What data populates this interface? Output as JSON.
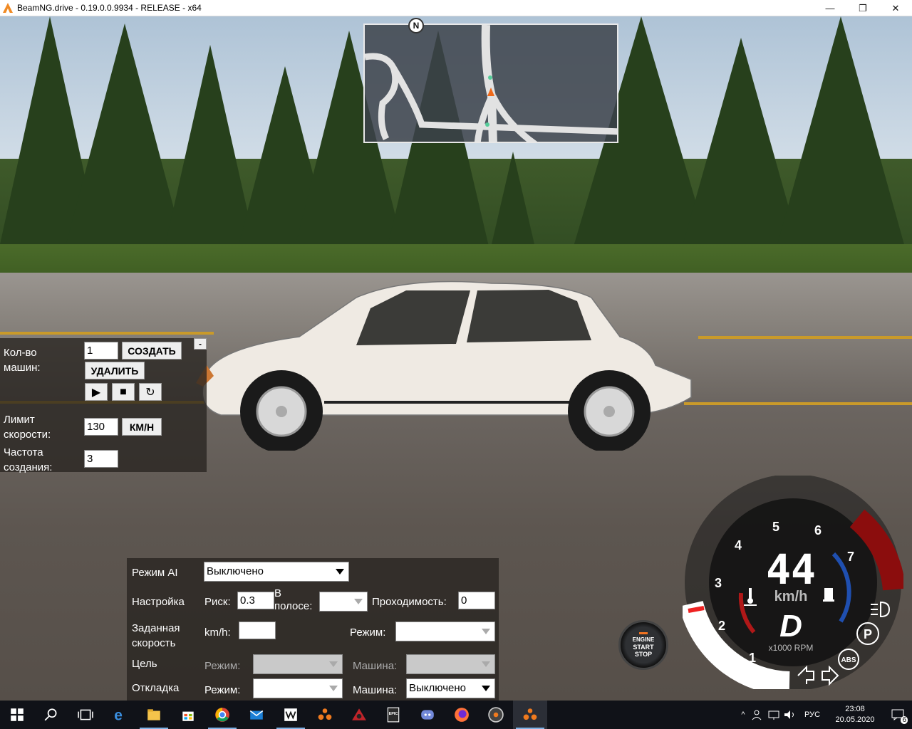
{
  "window": {
    "title": "BeamNG.drive - 0.19.0.0.9934 - RELEASE - x64",
    "minimize_glyph": "—",
    "maximize_glyph": "❐",
    "close_glyph": "✕"
  },
  "minimap": {
    "north_label": "N"
  },
  "spawn_panel": {
    "count_label_1": "Кол-во",
    "count_label_2": "машин:",
    "count_value": "1",
    "create_label": "СОЗДАТЬ",
    "delete_label": "УДАЛИТЬ",
    "collapse_label": "-",
    "play_glyph": "▶",
    "stop_glyph": "■",
    "refresh_glyph": "↻",
    "speed_limit_label_1": "Лимит",
    "speed_limit_label_2": "скорости:",
    "speed_limit_value": "130",
    "speed_unit_label": "КМ/Н",
    "spawn_rate_label_1": "Частота",
    "spawn_rate_label_2": "создания:",
    "spawn_rate_value": "3"
  },
  "ai_panel": {
    "mode_label": "Режим AI",
    "mode_value": "Выключено",
    "tuning_label": "Настройка",
    "risk_label": "Риск:",
    "risk_value": "0.3",
    "lane_label_1": "В",
    "lane_label_2": "полосе:",
    "lane_value": "",
    "offroad_label": "Проходимость:",
    "offroad_value": "0",
    "target_speed_label_1": "Заданная",
    "target_speed_label_2": "скорость",
    "kmh_label": "km/h:",
    "kmh_value": "",
    "speed_mode_label": "Режим:",
    "speed_mode_value": "",
    "target_label": "Цель",
    "target_mode_label": "Режим:",
    "target_mode_value": "",
    "target_vehicle_label": "Машина:",
    "target_vehicle_value": "",
    "debug_label": "Откладка",
    "debug_mode_label": "Режим:",
    "debug_mode_value": "",
    "debug_vehicle_label": "Машина:",
    "debug_vehicle_value": "Выключено"
  },
  "engine_button": {
    "line1": "ENGINE",
    "line2": "START",
    "line3": "STOP"
  },
  "gauge": {
    "speed": "44",
    "unit": "km/h",
    "gear": "D",
    "rpm_label": "x1000 RPM",
    "rpm_ticks": [
      "1",
      "2",
      "3",
      "4",
      "5",
      "6",
      "7"
    ],
    "abs_label": "ABS",
    "parking_label": "P",
    "redline_color": "#8b0d0d",
    "rpm_fill_color": "#ffffff",
    "fuel_bar_color": "#1f4fb0",
    "temp_bar_color": "#b01818"
  },
  "taskbar": {
    "apps": [
      "start-icon",
      "search-icon",
      "task-view-icon",
      "edge-icon",
      "file-explorer-icon",
      "store-icon",
      "chrome-icon",
      "mail-icon",
      "watch-dogs-icon",
      "beamng-icon",
      "red-app-icon",
      "epic-games-icon",
      "discord-icon",
      "firefox-icon",
      "media-player-icon",
      "beamng-active-icon"
    ],
    "language": "РУС",
    "time": "23:08",
    "date": "20.05.2020",
    "notification_count": "6"
  }
}
